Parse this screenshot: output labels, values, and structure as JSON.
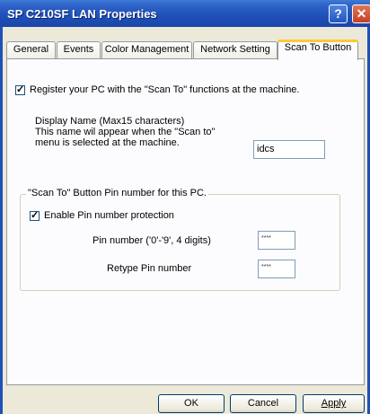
{
  "window": {
    "title": "SP C210SF LAN Properties",
    "help_glyph": "?",
    "close_glyph": "✕"
  },
  "tabs": [
    {
      "label": "General"
    },
    {
      "label": "Events"
    },
    {
      "label": "Color Management"
    },
    {
      "label": "Network Setting"
    },
    {
      "label": "Scan To Button"
    }
  ],
  "active_tab": "Scan To Button",
  "register": {
    "checked": true,
    "check_glyph": "✓",
    "label": "Register your PC with the \"Scan To\" functions at the machine."
  },
  "display_name": {
    "line1": "Display Name (Max15 characters)",
    "line2": "This name wil appear when the \"Scan to\"",
    "line3": "menu is selected at the machine.",
    "value": "idcs"
  },
  "pin_group": {
    "legend": "\"Scan To\" Button Pin number for this PC.",
    "enable_checked": true,
    "enable_label": "Enable Pin number protection",
    "pin_label": "Pin number ('0'-'9', 4 digits)",
    "pin_value": "****",
    "retype_label": "Retype Pin number",
    "retype_value": "****"
  },
  "buttons": {
    "ok": "OK",
    "cancel": "Cancel",
    "apply": "Apply"
  },
  "colors": {
    "titlebar": "#1f4fb8",
    "tab_highlight": "#ffc83c",
    "panel": "#fcfcfe",
    "dialog": "#ece9d8"
  }
}
